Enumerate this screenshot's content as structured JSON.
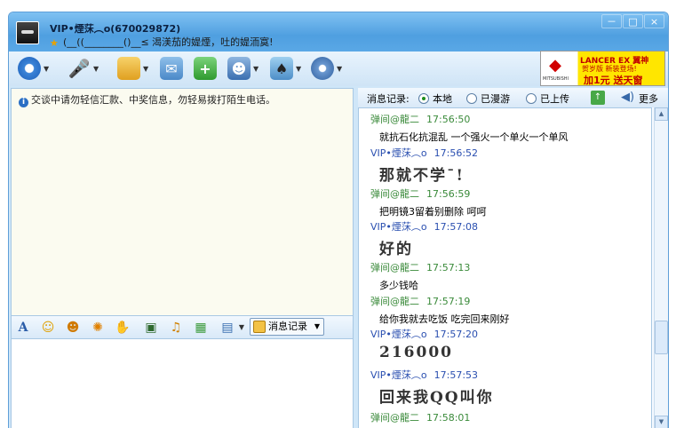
{
  "window": {
    "user_name": "VIP•煙莯︵o(670029872)",
    "status_text": "(__((________()__≤ 渴渼茄的媞煙，吐的媞洏寞!",
    "controls": {
      "minimize": "－",
      "maximize": "□",
      "close": "×"
    }
  },
  "toolbar": {
    "items": [
      "video-icon",
      "mic-icon",
      "file-transfer-icon",
      "mail-icon",
      "add-app-icon",
      "remote-assist-icon",
      "game-icon",
      "settings-icon"
    ]
  },
  "ad": {
    "brand": "MITSUBISHI",
    "line1": "LANCER EX 翼神",
    "line2": "贺岁版 新装登场!",
    "line3": "加1元 送天窗"
  },
  "notice": "交谈中请勿轻信汇款、中奖信息，勿轻易拨打陌生电话。",
  "input_toolbar": {
    "icons": [
      "font-icon",
      "smiley-icon",
      "magic-face-icon",
      "shake-icon",
      "thumb-icon",
      "screenshot-icon",
      "music-icon",
      "gift-icon",
      "more-icon"
    ],
    "message_log_label": "消息记录"
  },
  "history_panel": {
    "label": "消息记录:",
    "options": [
      "本地",
      "已漫游",
      "已上传"
    ],
    "selected": "本地",
    "more_label": "更多"
  },
  "messages": [
    {
      "sender": "弹间@龍二",
      "time": "17:56:50",
      "text": "就抗石化抗混乱 一个强火一个单火一个单风",
      "big": false,
      "peer": true
    },
    {
      "sender": "VIP•煙莯︵o",
      "time": "17:56:52",
      "text": "那就不学¯!",
      "big": true,
      "peer": false
    },
    {
      "sender": "弹间@龍二",
      "time": "17:56:59",
      "text": "把明镜3留着别删除 呵呵",
      "big": false,
      "peer": true
    },
    {
      "sender": "VIP•煙莯︵o",
      "time": "17:57:08",
      "text": "好的",
      "big": true,
      "peer": false
    },
    {
      "sender": "弹间@龍二",
      "time": "17:57:13",
      "text": "多少钱哈",
      "big": false,
      "peer": true
    },
    {
      "sender": "弹间@龍二",
      "time": "17:57:19",
      "text": "给你我就去吃饭 吃完回来刚好",
      "big": false,
      "peer": true
    },
    {
      "sender": "VIP•煙莯︵o",
      "time": "17:57:20",
      "text": "216000",
      "big": true,
      "peer": false
    },
    {
      "sender": "VIP•煙莯︵o",
      "time": "17:57:53",
      "text": "回来我QQ叫你",
      "big": true,
      "peer": false
    },
    {
      "sender": "弹间@龍二",
      "time": "17:58:01",
      "text": "",
      "big": false,
      "peer": true
    }
  ]
}
